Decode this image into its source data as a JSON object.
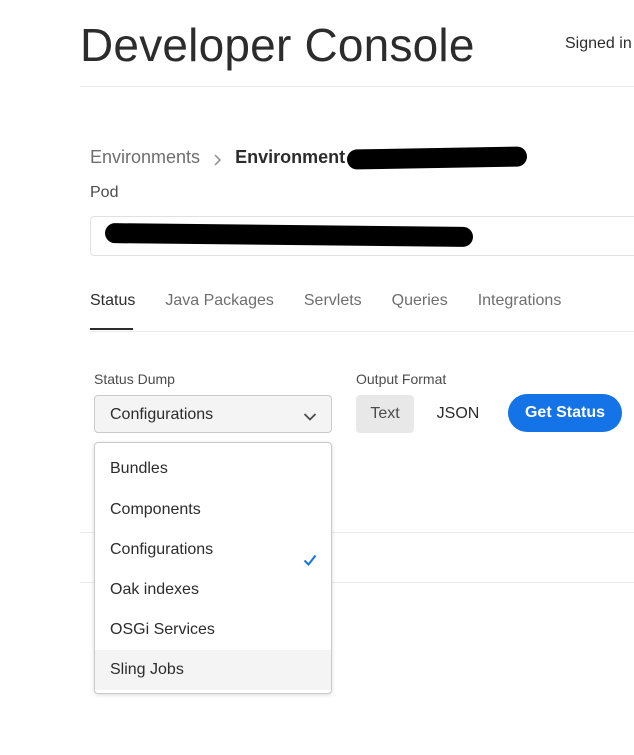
{
  "header": {
    "title": "Developer Console",
    "signed_in": "Signed in"
  },
  "breadcrumb": {
    "environments": "Environments",
    "environment": "Environment"
  },
  "pod": {
    "label": "Pod",
    "value": ""
  },
  "tabs": [
    {
      "label": "Status",
      "active": true
    },
    {
      "label": "Java Packages",
      "active": false
    },
    {
      "label": "Servlets",
      "active": false
    },
    {
      "label": "Queries",
      "active": false
    },
    {
      "label": "Integrations",
      "active": false
    }
  ],
  "status_dump": {
    "label": "Status Dump",
    "selected": "Configurations",
    "options": [
      {
        "label": "Bundles",
        "selected": false
      },
      {
        "label": "Components",
        "selected": false
      },
      {
        "label": "Configurations",
        "selected": true
      },
      {
        "label": "Oak indexes",
        "selected": false
      },
      {
        "label": "OSGi Services",
        "selected": false
      },
      {
        "label": "Sling Jobs",
        "selected": false,
        "hovered": true
      }
    ]
  },
  "output_format": {
    "label": "Output Format",
    "options": [
      "Text",
      "JSON"
    ],
    "selected": "Text"
  },
  "get_status_button": "Get Status",
  "colors": {
    "accent": "#1473e6",
    "text": "#2c2c2c",
    "muted": "#6e6e6e"
  }
}
